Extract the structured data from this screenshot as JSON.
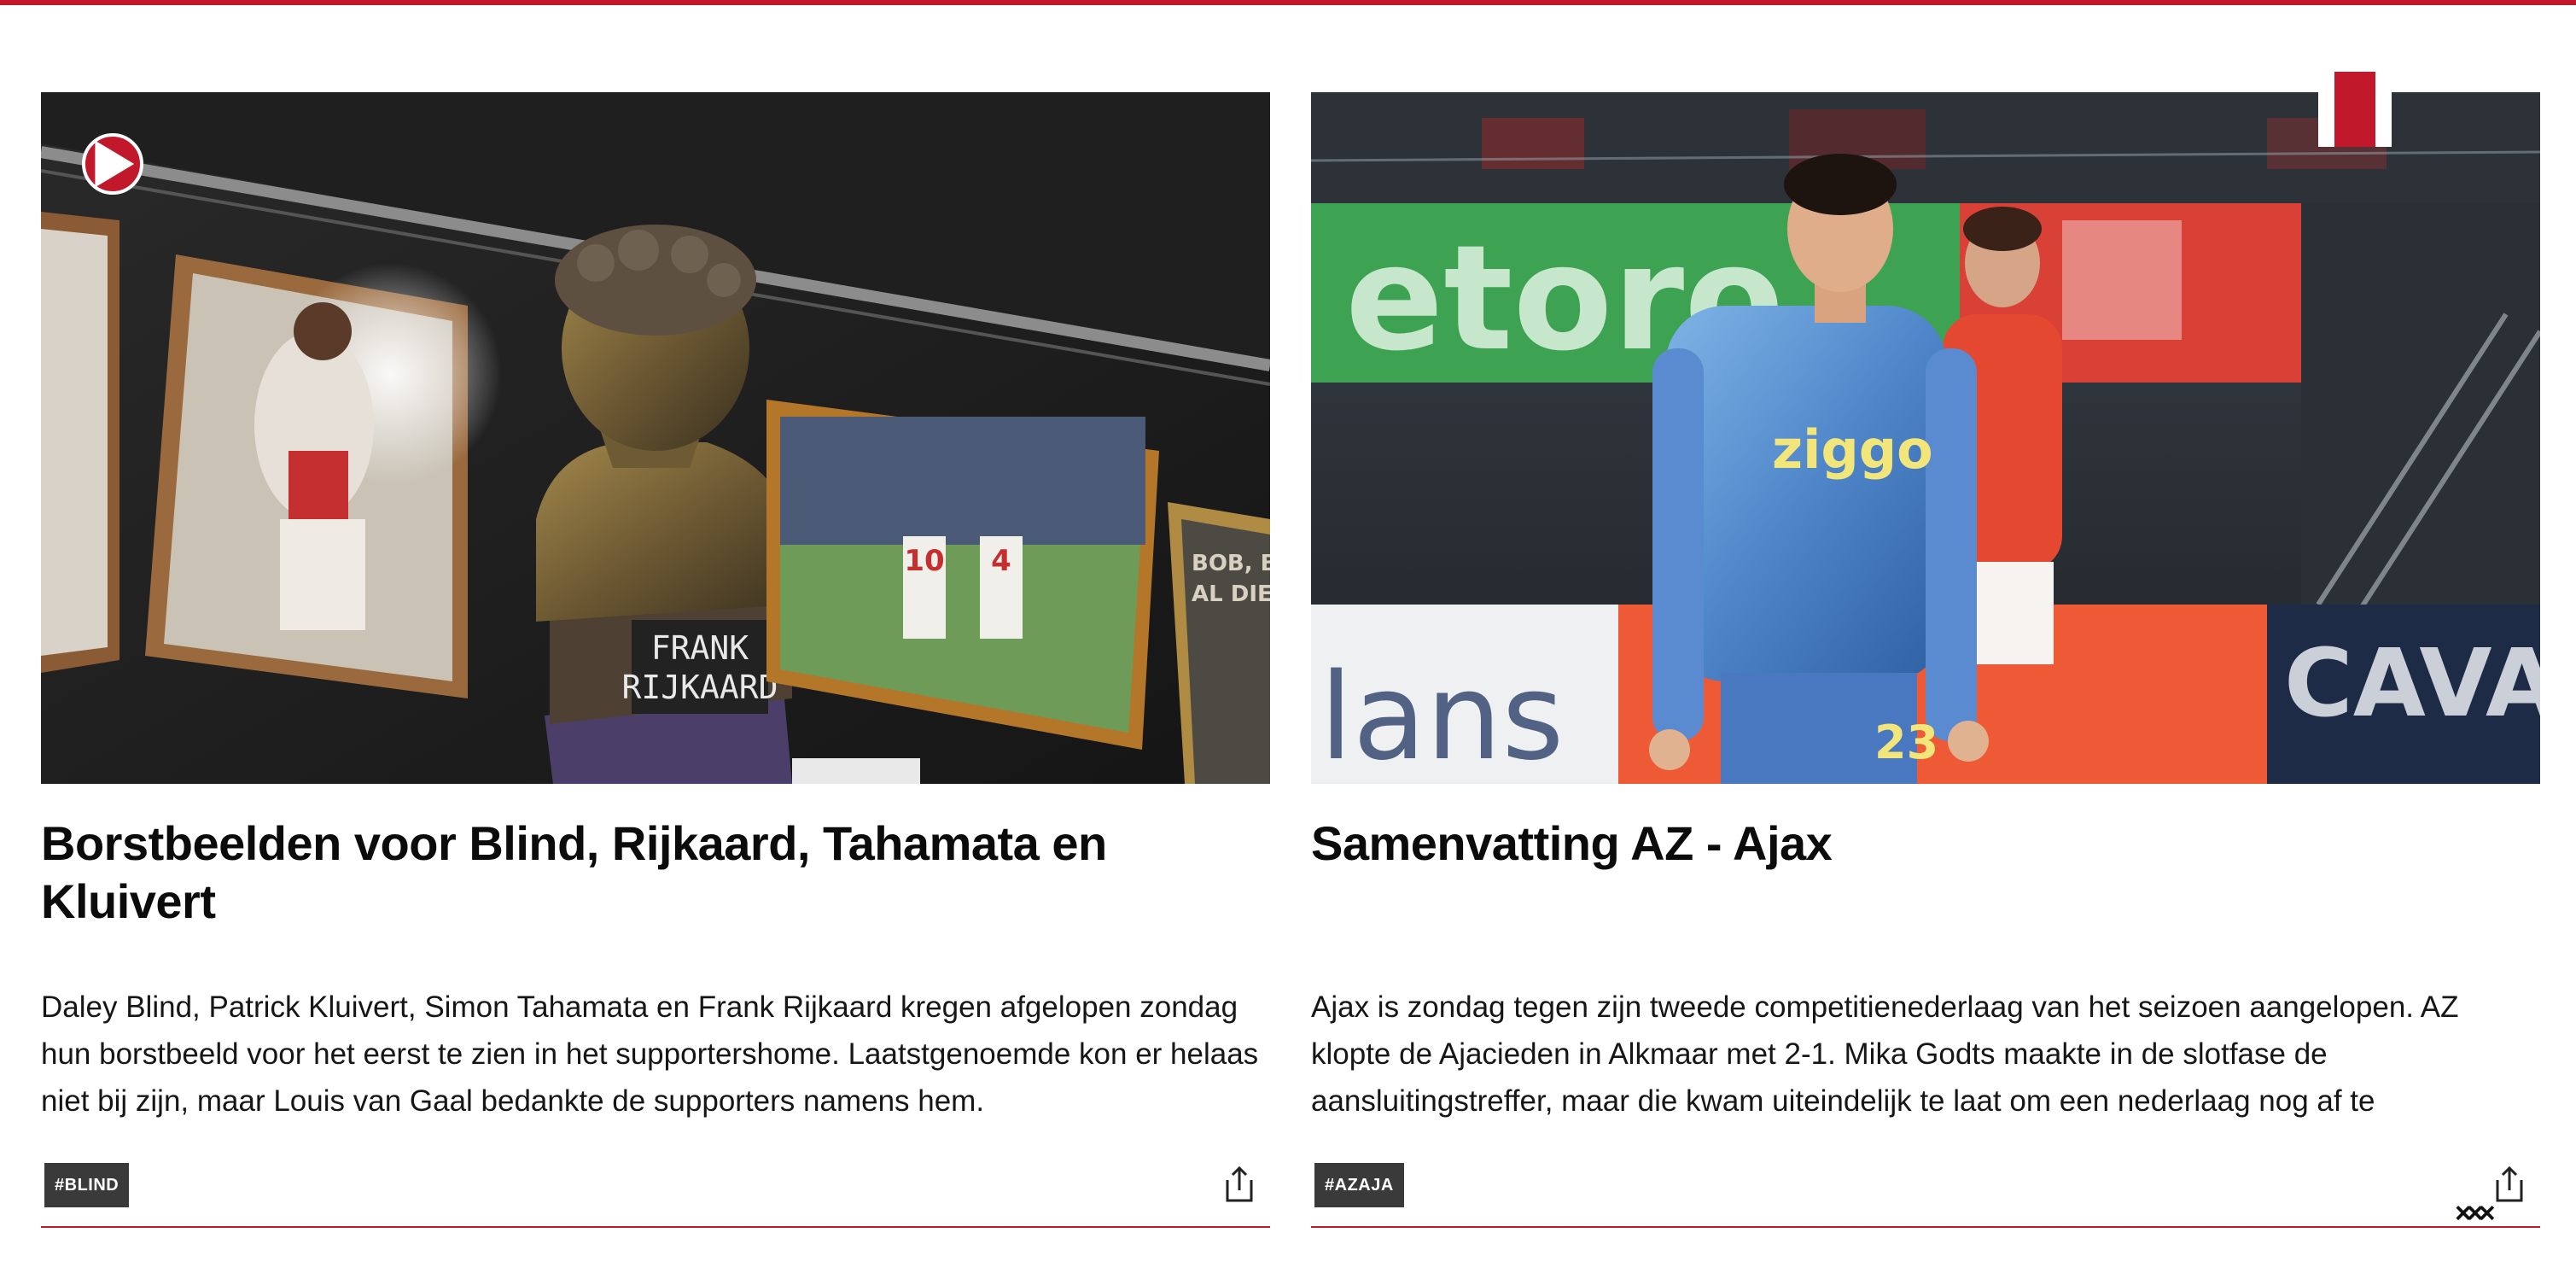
{
  "articles": [
    {
      "headline": "Borstbeelden voor Blind, Rijkaard, Tahamata en Kluivert",
      "summary": "Daley Blind, Patrick Kluivert, Simon Tahamata en Frank Rijkaard kregen afgelopen zondag hun borstbeeld voor het eerst te zien in het supportershome. Laatstgenoemde kon er helaas niet bij zijn, maar Louis van Gaal bedankte de supporters namens hem.",
      "tag": "#BLIND",
      "media_icon": "play-icon",
      "image_text": {
        "plaque_line1": "FRANK",
        "plaque_line2": "RIJKAARD",
        "poster_line1": "BOB, BEDA",
        "poster_line2": "AL DIE MO",
        "shirt_number_a": "10",
        "shirt_number_b": "4"
      }
    },
    {
      "headline": "Samenvatting AZ - Ajax",
      "summary": "Ajax is zondag tegen zijn tweede competitienederlaag van het seizoen aangelopen. AZ klopte de Ajacieden in Alkmaar met 2-1. Mika Godts maakte in de slotfase de aansluitingstreffer, maar die kwam uiteindelijk te laat om een nederlaag nog af te",
      "tag": "#AZAJA",
      "image_text": {
        "board_left": "etoro",
        "board_bottom_left": "lans",
        "board_bottom_right": "CAVA",
        "shirt_sponsor": "ziggo",
        "shirt_number": "23"
      }
    }
  ],
  "share_icon": "share-icon",
  "brand_mark": "×××",
  "colors": {
    "accent": "#c2182b",
    "tag_bg": "#3a3a3a",
    "text": "#111111"
  }
}
